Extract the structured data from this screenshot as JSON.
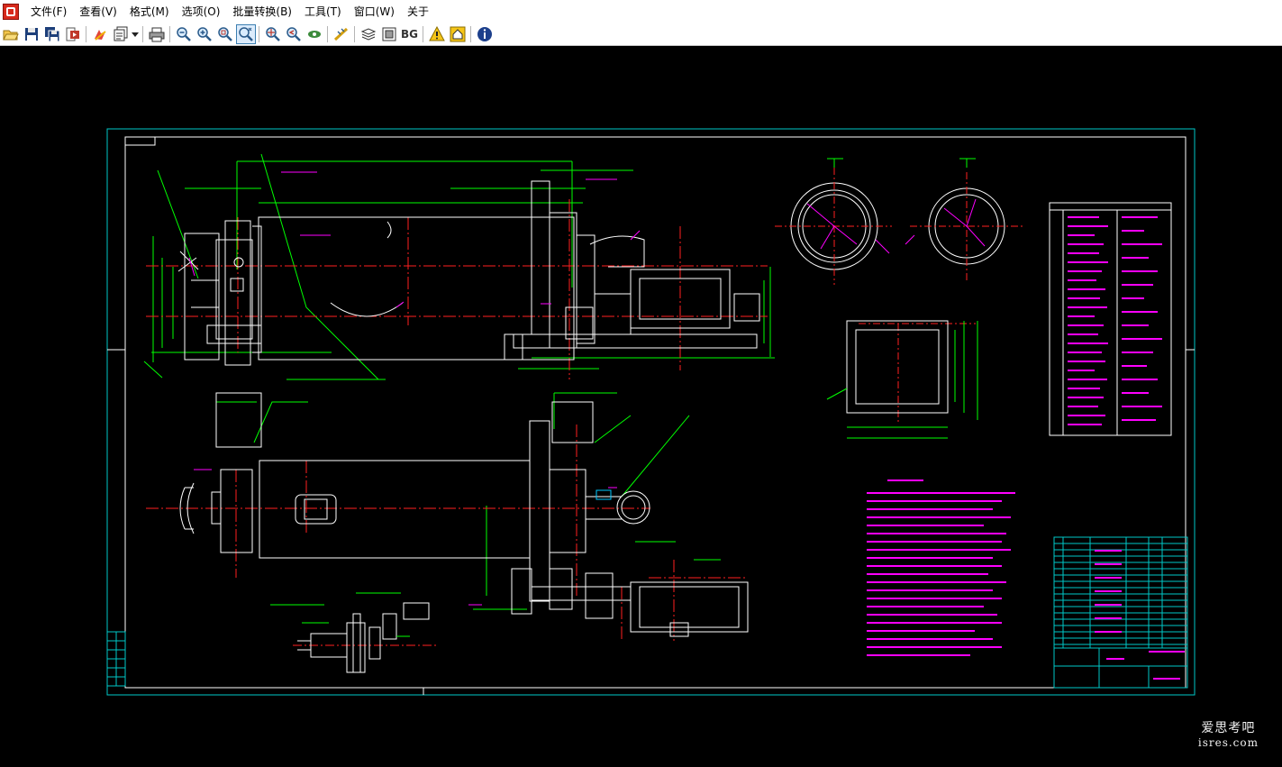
{
  "app": {
    "name": "CAD viewer"
  },
  "menu": {
    "items": [
      {
        "label": "文件(F)"
      },
      {
        "label": "查看(V)"
      },
      {
        "label": "格式(M)"
      },
      {
        "label": "选项(O)"
      },
      {
        "label": "批量转换(B)"
      },
      {
        "label": "工具(T)"
      },
      {
        "label": "窗口(W)"
      },
      {
        "label": "关于"
      }
    ]
  },
  "toolbar": {
    "buttons": [
      {
        "icon": "open-folder-icon"
      },
      {
        "icon": "save-icon"
      },
      {
        "icon": "save-all-icon"
      },
      {
        "icon": "export-icon"
      },
      {
        "icon": "layers-icon"
      },
      {
        "icon": "pages-icon"
      },
      {
        "icon": "print-icon"
      },
      {
        "icon": "zoom-out-icon"
      },
      {
        "icon": "zoom-in-icon"
      },
      {
        "icon": "zoom-window-icon"
      },
      {
        "icon": "zoom-realtime-icon"
      },
      {
        "icon": "zoom-extents-icon"
      },
      {
        "icon": "zoom-previous-icon"
      },
      {
        "icon": "view-icon"
      },
      {
        "icon": "measure-icon"
      },
      {
        "icon": "layer-manager-icon"
      },
      {
        "icon": "frame-icon"
      },
      {
        "icon": "background-color-icon"
      },
      {
        "icon": "warning-icon"
      },
      {
        "icon": "home-icon"
      },
      {
        "icon": "info-icon"
      }
    ],
    "bg_label": "BG"
  },
  "colors": {
    "canvas_bg": "#000000",
    "frame": "#00c8c8",
    "geometry": "#ffffff",
    "dimensions": "#00ff00",
    "centerlines": "#ff2020",
    "annotations": "#ff00ff"
  },
  "watermark": {
    "line1": "爱思考吧",
    "line2": "isres.com"
  }
}
